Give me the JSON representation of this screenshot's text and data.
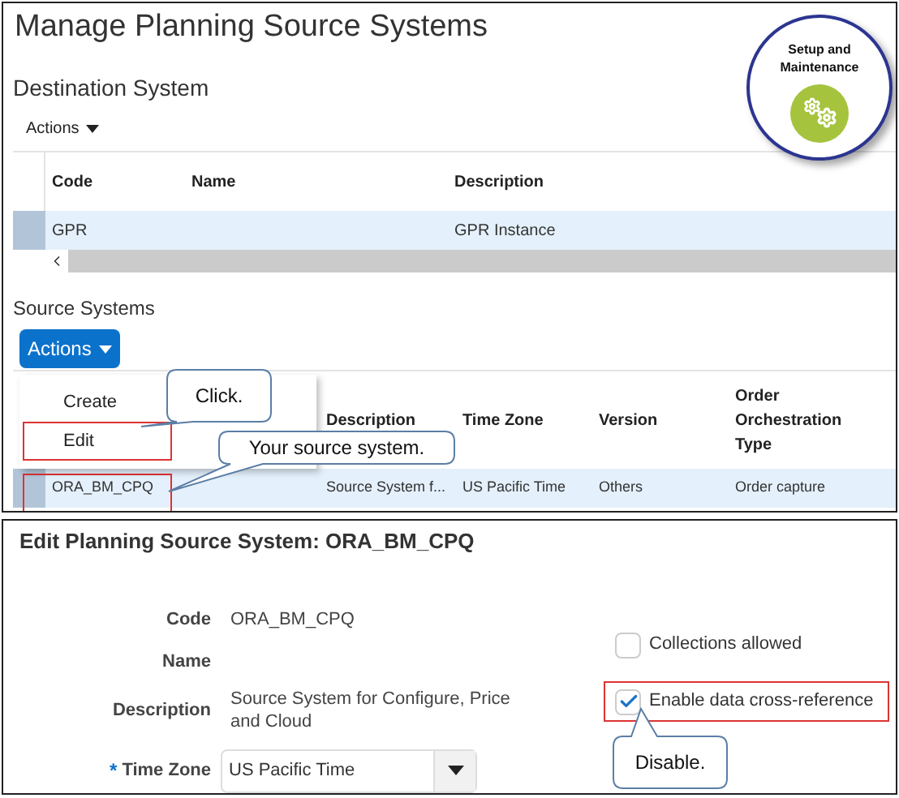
{
  "page_title": "Manage Planning Source Systems",
  "badge": {
    "text": "Setup and Maintenance"
  },
  "destination": {
    "heading": "Destination System",
    "actions": "Actions",
    "columns": [
      "Code",
      "Name",
      "Description"
    ],
    "rows": [
      {
        "code": "GPR",
        "description": "GPR Instance",
        "selected": true
      }
    ]
  },
  "source": {
    "heading": "Source Systems",
    "actions": "Actions",
    "menu": [
      {
        "label": "Create",
        "highlighted": false
      },
      {
        "label": "Edit",
        "highlighted": true
      }
    ],
    "columns": [
      "Description",
      "Time Zone",
      "Version",
      "Order Orchestration Type"
    ],
    "rows": [
      {
        "code": "ORA_BM_CPQ",
        "description": "Source System f...",
        "time_zone": "US Pacific Time",
        "version": "Others",
        "order_type": "Order capture",
        "selected": true,
        "highlighted": true
      }
    ]
  },
  "callouts": [
    {
      "text": "Click."
    },
    {
      "text": "Your source system."
    },
    {
      "text": "Disable."
    }
  ],
  "edit": {
    "title": "Edit Planning Source System: ORA_BM_CPQ",
    "fields": [
      {
        "kind": "text",
        "label": "Code",
        "value": "ORA_BM_CPQ"
      },
      {
        "kind": "text",
        "label": "Name"
      },
      {
        "kind": "text",
        "label": "Description",
        "value": "Source System for Configure, Price and Cloud"
      },
      {
        "kind": "select",
        "label": "Time Zone",
        "value": "US Pacific Time",
        "required_mark": "*"
      }
    ],
    "checkboxes": [
      {
        "label": "Collections allowed",
        "checked": false,
        "highlighted": false
      },
      {
        "label": "Enable data cross-reference",
        "checked": true,
        "highlighted": true
      }
    ]
  }
}
